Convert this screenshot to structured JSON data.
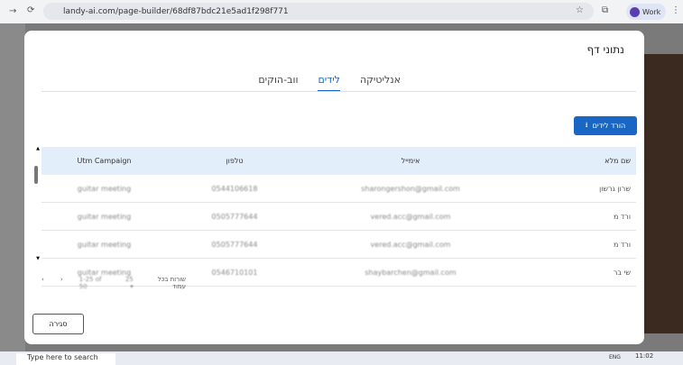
{
  "browser": {
    "url": "landy-ai.com/page-builder/68df87bdc21e5ad1f298f771",
    "profile": "Work"
  },
  "modal": {
    "title": "נתוני דף",
    "tabs": [
      {
        "label": "אנליטיקה",
        "active": false
      },
      {
        "label": "לידים",
        "active": true
      },
      {
        "label": "ווב-הוקים",
        "active": false
      }
    ],
    "download_label": "הורד לידים",
    "columns": [
      "שם מלא",
      "אימייל",
      "טלפון",
      "Utm Campaign"
    ],
    "rows": [
      [
        "שרון גרשון",
        "sharongershon@gmail.com",
        "0544106618",
        "guitar meeting"
      ],
      [
        "ורד מ",
        "vered.acc@gmail.com",
        "0505777644",
        "guitar meeting"
      ],
      [
        "ורד מ",
        "vered.acc@gmail.com",
        "0505777644",
        "guitar meeting"
      ],
      [
        "שי בר",
        "shaybarchen@gmail.com",
        "0546710101",
        "guitar meeting"
      ]
    ],
    "pagination": {
      "rows_per_page_label": "שורות בכל עמוד",
      "rows_per_page": "25",
      "range": "1-25 of 50"
    },
    "close_label": "סגירה"
  },
  "taskbar": {
    "search_placeholder": "Type here to search",
    "language": "ENG",
    "time": "11:02"
  },
  "colors": {
    "accent": "#1a66c4",
    "header_bg": "#e3eefb"
  }
}
